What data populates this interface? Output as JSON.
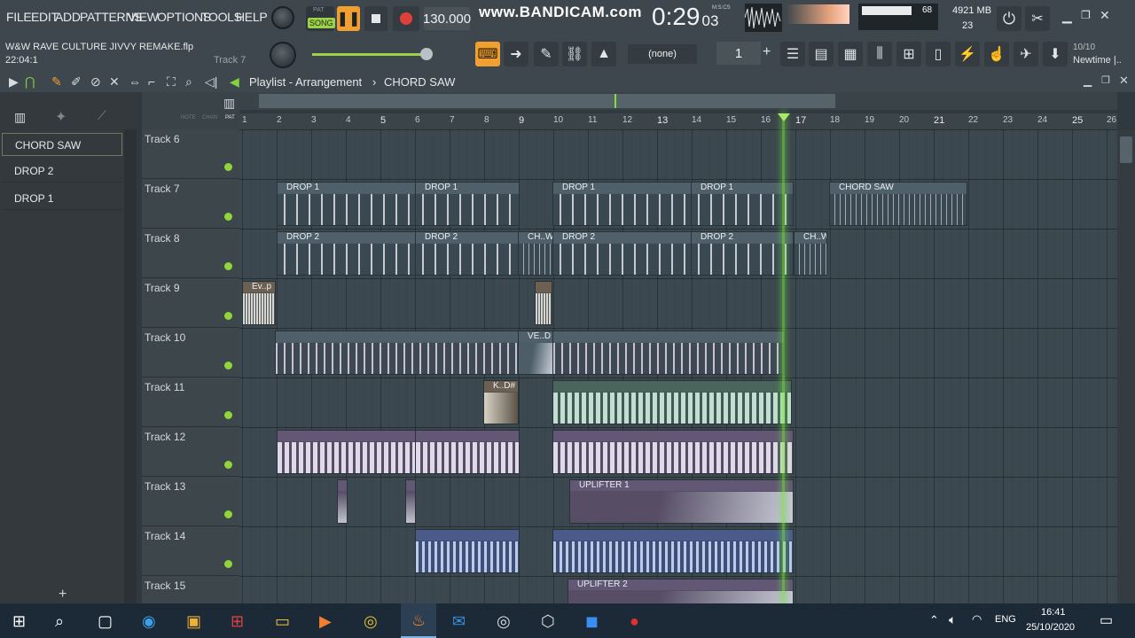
{
  "menu": [
    "FILE",
    "EDIT",
    "ADD",
    "PATTERNS",
    "VIEW",
    "OPTIONS",
    "TOOLS",
    "HELP"
  ],
  "transport": {
    "pat_label": "PAT",
    "song_label": "SONG",
    "tempo": "130.000",
    "time": "0:29",
    "time_small": "03",
    "time_unit": "M:S:CS"
  },
  "watermark": "www.BANDICAM.com",
  "stats": {
    "cpu": "68",
    "ram": "4921 MB",
    "poly": "23"
  },
  "project": {
    "file": "W&W RAVE CULTURE JIVVY REMAKE.flp",
    "position": "22:04:1",
    "hint": "Track 7"
  },
  "snap": "(none)",
  "step": "1",
  "news": {
    "count": "10/10",
    "label": "Newtime |.."
  },
  "playlist": {
    "title": "Playlist - Arrangement",
    "pattern": "CHORD SAW"
  },
  "patterns": [
    "CHORD SAW",
    "DROP 2",
    "DROP 1"
  ],
  "ruler_labels": [
    "NOTE",
    "CHAN",
    "PAT"
  ],
  "bars": [
    "1",
    "2",
    "3",
    "4",
    "5",
    "6",
    "7",
    "8",
    "9",
    "10",
    "11",
    "12",
    "13",
    "14",
    "15",
    "16",
    "17",
    "18",
    "19",
    "20",
    "21",
    "22",
    "23",
    "24",
    "25",
    "26"
  ],
  "tracks": [
    "Track 6",
    "Track 7",
    "Track 8",
    "Track 9",
    "Track 10",
    "Track 11",
    "Track 12",
    "Track 13",
    "Track 14",
    "Track 15"
  ],
  "clip_labels": {
    "drop1": "DROP 1",
    "drop2": "DROP 2",
    "chordsaw": "CHORD SAW",
    "chw": "CH..W",
    "evp": "Ev..p",
    "ved": "VE..D",
    "kd": "K..D#",
    "uplifter1": "UPLIFTER 1",
    "uplifter2": "UPLIFTER 2"
  },
  "taskbar": {
    "lang": "ENG",
    "time": "16:41",
    "date": "25/10/2020"
  },
  "colors": {
    "accent": "#f0a030",
    "led": "#8fd63a",
    "playhead": "#7fe03a"
  }
}
